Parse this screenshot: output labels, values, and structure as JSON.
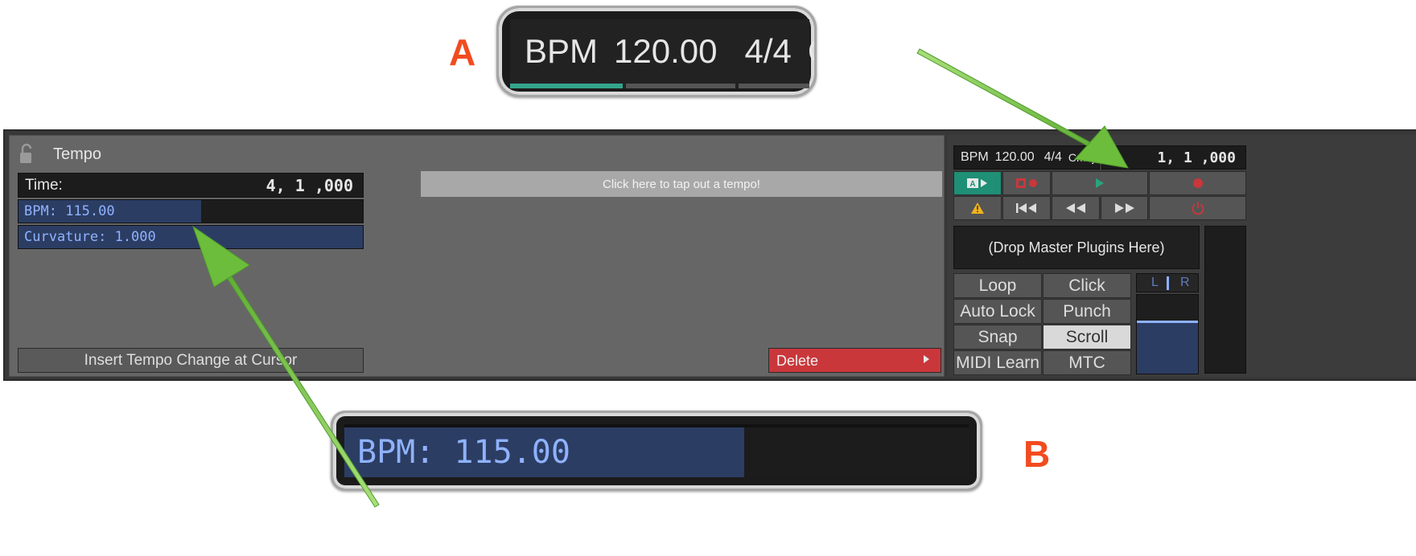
{
  "callout_a": {
    "letter": "A",
    "bpm_label": "BPM",
    "bpm_value": "120.00",
    "meter": "4/4",
    "cut_text": "C"
  },
  "callout_b": {
    "letter": "B",
    "bpm_text": "BPM: 115.00",
    "fill_fraction": 0.64
  },
  "tempo_panel": {
    "title": "Tempo",
    "time_label": "Time:",
    "time_value": "4, 1 ,000",
    "bpm_text": "BPM: 115.00",
    "bpm_fill_fraction": 0.53,
    "curvature_text": "Curvature: 1.000",
    "tap_label": "Click here to tap out a tempo!",
    "insert_label": "Insert Tempo Change at Cursor",
    "delete_label": "Delete"
  },
  "transport": {
    "bpm_label": "BPM",
    "bpm_value": "120.00",
    "meter": "4/4",
    "key": "Cmaj",
    "position": "1, 1 ,000",
    "drop_label": "(Drop Master Plugins Here)",
    "buttons": {
      "loop": "Loop",
      "click": "Click",
      "auto_lock": "Auto Lock",
      "punch": "Punch",
      "snap": "Snap",
      "scroll": "Scroll",
      "midi_learn": "MIDI Learn",
      "mtc": "MTC"
    },
    "meter_left": "L",
    "meter_right": "R"
  },
  "colors": {
    "accent_orange": "#f24b1f",
    "arrow_green": "#7cc84a",
    "value_blue": "#8fb2ff",
    "bar_fill": "#2c3d63",
    "delete_red": "#c9373b",
    "teal_button": "#1f8f75"
  }
}
